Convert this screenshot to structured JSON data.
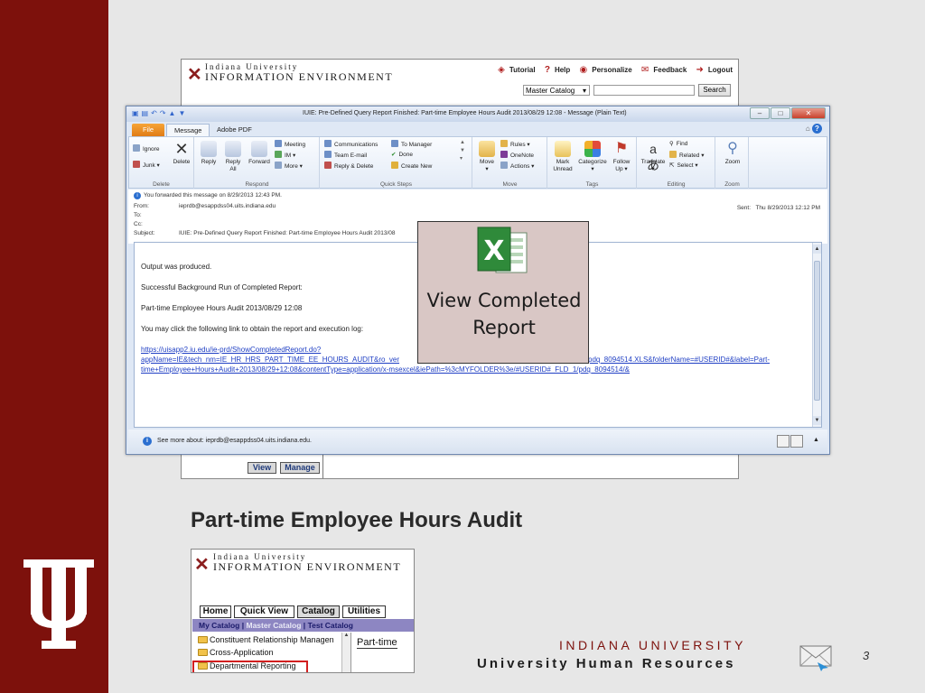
{
  "iie": {
    "wordmark_line1": "Indiana University",
    "wordmark_line2": "Information Environment",
    "top_links": [
      "Tutorial",
      "Help",
      "Personalize",
      "Feedback",
      "Logout"
    ],
    "catalog_select": "Master Catalog",
    "search_value": "",
    "search_label": "Search",
    "bottom_buttons": [
      "View",
      "Manage"
    ]
  },
  "outlook": {
    "window_title": "IUIE: Pre-Defined Query Report Finished: Part-time Employee Hours Audit 2013/08/29 12:08  -  Message (Plain Text)",
    "tabs": [
      "File",
      "Message",
      "Adobe PDF"
    ],
    "ribbon": {
      "delete_group": {
        "label": "Delete",
        "ignore": "Ignore",
        "junk": "Junk",
        "delete": "Delete"
      },
      "respond_group": {
        "label": "Respond",
        "reply": "Reply",
        "reply_all_1": "Reply",
        "reply_all_2": "All",
        "forward": "Forward",
        "meeting": "Meeting",
        "im": "IM",
        "more": "More"
      },
      "quicksteps_group": {
        "label": "Quick Steps",
        "items": [
          "Communications",
          "Team E-mail",
          "Reply & Delete",
          "To Manager",
          "Done",
          "Create New"
        ]
      },
      "move_group": {
        "label": "Move",
        "move": "Move",
        "rules": "Rules",
        "onenote": "OneNote",
        "actions": "Actions"
      },
      "tags_group": {
        "label": "Tags",
        "mark_1": "Mark",
        "mark_2": "Unread",
        "categorize": "Categorize",
        "follow_1": "Follow",
        "follow_2": "Up"
      },
      "editing_group": {
        "label": "Editing",
        "translate": "Translate",
        "find": "Find",
        "related": "Related",
        "select": "Select"
      },
      "zoom_group": {
        "label": "Zoom",
        "zoom": "Zoom"
      }
    },
    "header": {
      "info": "You forwarded this message on 8/29/2013 12:43 PM.",
      "from_label": "From:",
      "from_value": "ieprdb@esappdss04.uits.indiana.edu",
      "to_label": "To:",
      "cc_label": "Cc:",
      "subject_label": "Subject:",
      "subject_value": "IUIE: Pre-Defined Query Report Finished: Part-time Employee Hours Audit 2013/08",
      "sent_label": "Sent:",
      "sent_value": "Thu 8/29/2013 12:12 PM"
    },
    "body": {
      "line1": "Output was produced.",
      "line2": "Successful Background Run of Completed Report:",
      "line3": "Part-time Employee Hours Audit 2013/08/29 12:08",
      "line4": "You may click the following link to obtain the report and execution log:",
      "link1": "https://uisapp2.iu.edu/ie-prd/ShowCompletedReport.do?",
      "link2a": "appName=IE&tech_nm=IE_HR_HRS_PART_TIME_EE_HOURS_AUDIT&ro_ver",
      "link2b": "pdq_8094514.XLS&folderName=#USERID#&label=Part-",
      "link3": "time+Employee+Hours+Audit+2013/08/29+12:08&contentType=application/x-msexcel&iePath=%3cMYFOLDER%3e/#USERID#_FLD_1/pdq_8094514/&"
    },
    "people_pane": "See more about: ieprdb@esappdss04.uits.indiana.edu."
  },
  "callout": {
    "line1": "View Completed",
    "line2": "Report"
  },
  "slide": {
    "title": "Part-time Employee Hours Audit",
    "footer_university": "INDIANA UNIVERSITY",
    "footer_department": "University Human Resources",
    "page_number": "3"
  },
  "iie_preview": {
    "wordmark_line1": "Indiana University",
    "wordmark_line2": "Information Environment",
    "nav_tabs": [
      "Home",
      "Quick View",
      "Catalog",
      "Utilities"
    ],
    "subnav": {
      "my_catalog": "My Catalog",
      "sep1": "|",
      "master_catalog": "Master Catalog",
      "sep2": "|",
      "test_catalog": "Test Catalog"
    },
    "list_items": [
      "Constituent Relationship Managen",
      "Cross-Application",
      "Departmental Reporting"
    ],
    "right_panel_text": "Part-time"
  },
  "colors": {
    "brand_crimson": "#7d110c",
    "link_blue": "#1f3fc4",
    "subnav_purple": "#8d86c2",
    "highlight_red": "#d21f1f"
  }
}
